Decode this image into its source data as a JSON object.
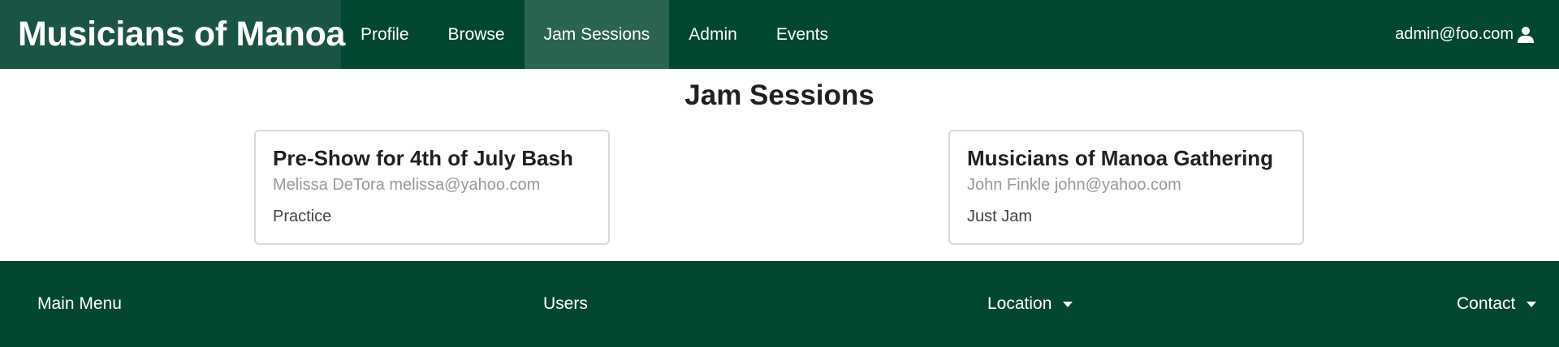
{
  "navbar": {
    "brand": "Musicians of Manoa",
    "items": [
      {
        "label": "Profile",
        "active": false
      },
      {
        "label": "Browse",
        "active": false
      },
      {
        "label": "Jam Sessions",
        "active": true
      },
      {
        "label": "Admin",
        "active": false
      },
      {
        "label": "Events",
        "active": false
      }
    ],
    "user_email": "admin@foo.com",
    "user_icon": "user-icon"
  },
  "main": {
    "title": "Jam Sessions",
    "cards": [
      {
        "title": "Pre-Show for 4th of July Bash",
        "meta": "Melissa DeTora melissa@yahoo.com",
        "description": "Practice"
      },
      {
        "title": "Musicians of Manoa Gathering",
        "meta": "John Finkle john@yahoo.com",
        "description": "Just Jam"
      }
    ]
  },
  "footer": {
    "items": [
      {
        "label": "Main Menu",
        "dropdown": false
      },
      {
        "label": "Users",
        "dropdown": false
      },
      {
        "label": "Location",
        "dropdown": true
      },
      {
        "label": "Contact",
        "dropdown": true
      }
    ]
  },
  "colors": {
    "primary": "#024731",
    "brand_bg": "#1b5444",
    "active_tab": "#2b6452"
  }
}
